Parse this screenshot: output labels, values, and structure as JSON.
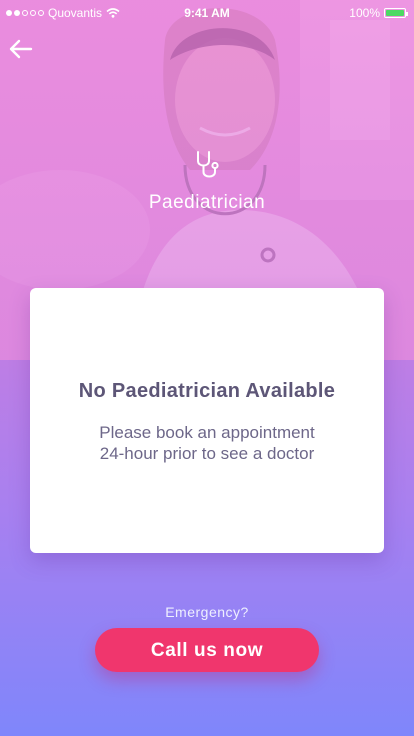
{
  "status_bar": {
    "carrier": "Quovantis",
    "time": "9:41 AM",
    "battery": "100%",
    "signal_bars_filled": 2,
    "signal_bars_total": 5,
    "battery_level": 1.0,
    "battery_color": "#4cd964"
  },
  "header": {
    "back_icon": "arrow-left-icon",
    "specialty_icon": "stethoscope-icon",
    "specialty": "Paediatrician"
  },
  "card": {
    "title": "No Paediatrician Available",
    "message_line1": "Please book an appointment",
    "message_line2": "24-hour prior to see a doctor"
  },
  "footer": {
    "emergency_label": "Emergency?",
    "call_button": "Call us now"
  },
  "colors": {
    "accent": "#f0366d",
    "card_text": "#5d5677",
    "gradient_top": "#dd7bd8",
    "gradient_bottom": "#7f86fb"
  }
}
